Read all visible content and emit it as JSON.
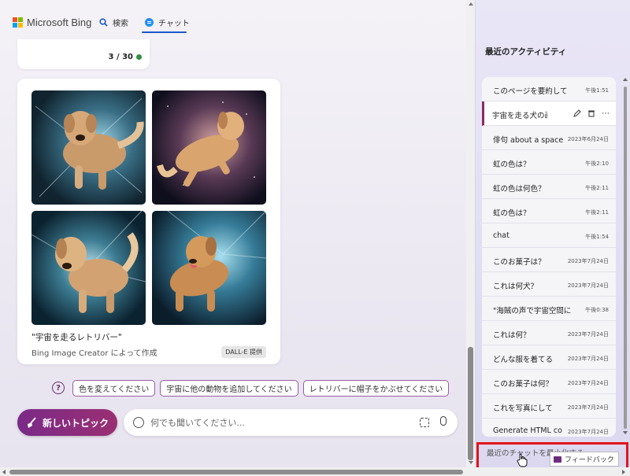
{
  "header": {
    "logo_text": "Microsoft Bing",
    "tabs": [
      {
        "label": "検索",
        "icon": "search-icon"
      },
      {
        "label": "チャット",
        "icon": "chat-icon",
        "active": true
      }
    ]
  },
  "counter": {
    "value": "3 / 30",
    "status_color": "#2f8f3e"
  },
  "image_result": {
    "caption": "\"宇宙を走るレトリバー\"",
    "creator": "Bing Image Creator によって作成",
    "badge": "DALL-E 提供"
  },
  "suggestions": [
    "色を変えてください",
    "宇宙に他の動物を追加してください",
    "レトリバーに帽子をかぶせてください"
  ],
  "composer": {
    "new_topic_label": "新しいトピック",
    "placeholder": "何でも聞いてください..."
  },
  "sidebar": {
    "title": "最近のアクティビティ",
    "items": [
      {
        "title": "このページを要約して",
        "date": "午後1:51"
      },
      {
        "title": "宇宙を走る犬の画像",
        "date": "",
        "active": true
      },
      {
        "title": "俳句 about a space",
        "date": "2023年6月24日"
      },
      {
        "title": "虹の色は？",
        "date": "午後2:10"
      },
      {
        "title": "虹の色は何色？",
        "date": "午後2:11"
      },
      {
        "title": "虹の色は？",
        "date": "午後2:11"
      },
      {
        "title": "chat",
        "date": "午後1:54"
      },
      {
        "title": "このお菓子は？",
        "date": "2023年7月24日"
      },
      {
        "title": "これは何犬？",
        "date": "2023年7月24日"
      },
      {
        "title": "\"海賊の声で宇宙空間に",
        "date": "午後0:38"
      },
      {
        "title": "これは何？",
        "date": "2023年7月24日"
      },
      {
        "title": "どんな服を着てる",
        "date": "2023年7月24日"
      },
      {
        "title": "このお菓子は何？",
        "date": "2023年7月24日"
      },
      {
        "title": "これを写真にして",
        "date": "2023年7月24日"
      },
      {
        "title": "Generate HTML co",
        "date": "2023年7月24日"
      }
    ],
    "minimize_label": "最近のチャットを最小化する",
    "feedback_label": "フィードバック"
  },
  "colors": {
    "accent": "#8a2a67",
    "highlight": "#e0141b",
    "brand_blue": "#1b58c9"
  }
}
